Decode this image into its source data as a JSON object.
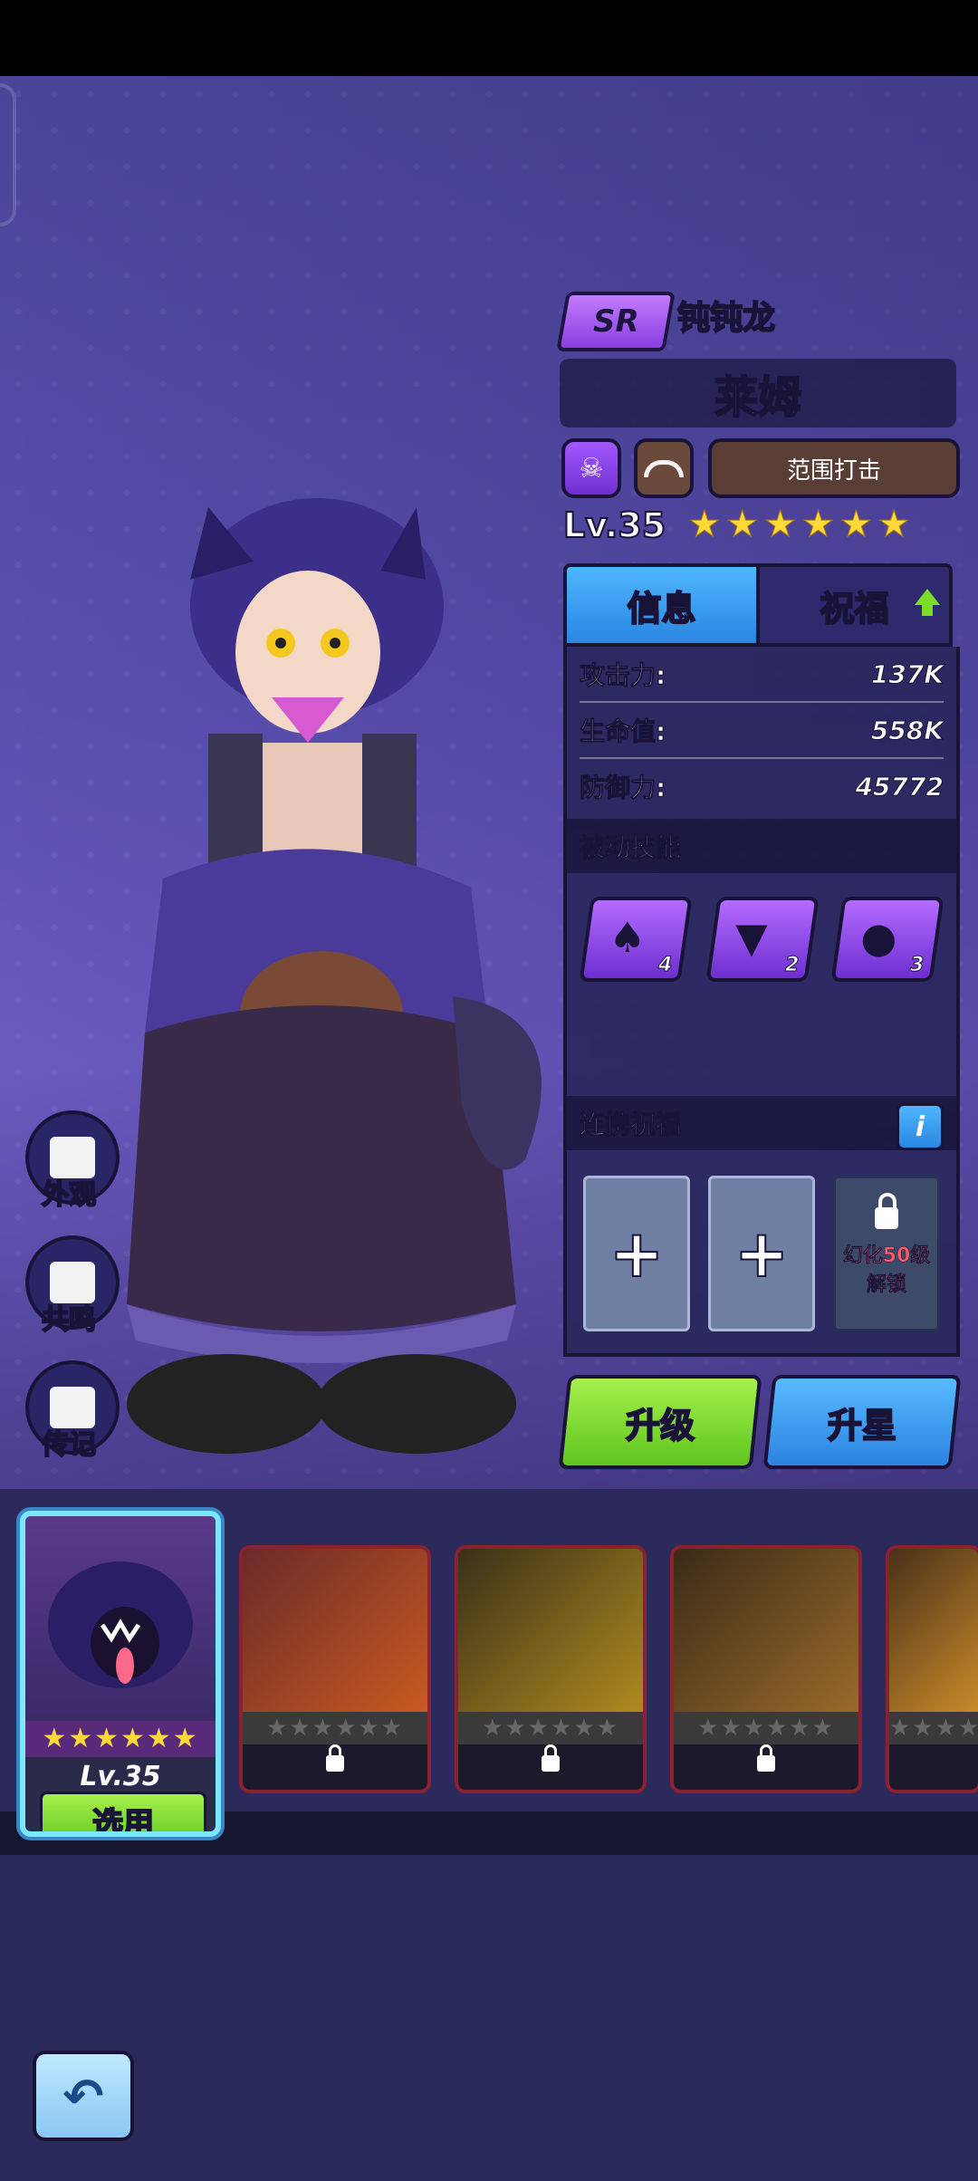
{
  "hero": {
    "rank": "SR",
    "species": "钝钝龙",
    "name": "莱姆",
    "attack_type": "范围打击",
    "level": "Lv.35",
    "stars": "★★★★★★"
  },
  "tabs": {
    "info": "信息",
    "blessing": "祝福"
  },
  "stats": [
    {
      "label": "攻击力:",
      "value": "137K"
    },
    {
      "label": "生命值:",
      "value": "558K"
    },
    {
      "label": "防御力:",
      "value": "45772"
    }
  ],
  "passive": {
    "title": "被动技能",
    "skills": [
      {
        "icon": "card-skull-icon",
        "count": "4"
      },
      {
        "icon": "potion-bag-icon",
        "count": "2"
      },
      {
        "icon": "splash-face-icon",
        "count": "3"
      }
    ]
  },
  "link": {
    "title": "连携祝福",
    "info_label": "i",
    "slots": [
      "+",
      "+"
    ],
    "locked_text_1": "幻化50级",
    "locked_text_2": "解锁"
  },
  "buttons": {
    "upgrade": "升级",
    "star_up": "升星"
  },
  "side": {
    "appearance": "外观",
    "resonance": "共鸣",
    "biography": "传记"
  },
  "roster": {
    "selected_level": "Lv.35",
    "selected_stars": "★★★★★★",
    "use_label": "选用",
    "locked_stars": "★★★★★★"
  },
  "colors": {
    "accent": "#7be8ff",
    "green": "#7cdc2a",
    "blue": "#2a86e0",
    "purple": "#8a3fe0"
  }
}
